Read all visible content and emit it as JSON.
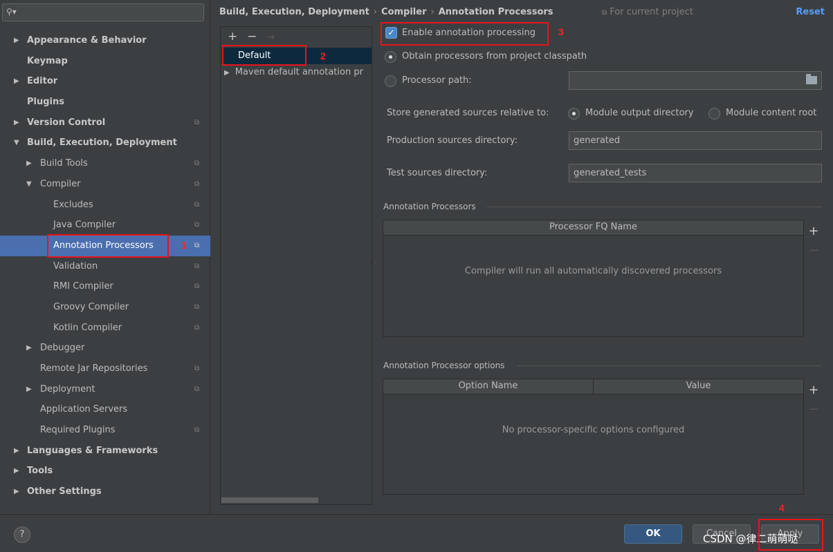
{
  "search": {
    "icon": "search-icon"
  },
  "nav": [
    {
      "label": "Appearance & Behavior",
      "arrow": "▶",
      "level": 0,
      "bold": true,
      "proj": false
    },
    {
      "label": "Keymap",
      "arrow": "",
      "level": 0,
      "bold": true,
      "proj": false
    },
    {
      "label": "Editor",
      "arrow": "▶",
      "level": 0,
      "bold": true,
      "proj": false
    },
    {
      "label": "Plugins",
      "arrow": "",
      "level": 0,
      "bold": true,
      "proj": false
    },
    {
      "label": "Version Control",
      "arrow": "▶",
      "level": 0,
      "bold": true,
      "proj": true
    },
    {
      "label": "Build, Execution, Deployment",
      "arrow": "▼",
      "level": 0,
      "bold": true,
      "proj": false
    },
    {
      "label": "Build Tools",
      "arrow": "▶",
      "level": 1,
      "bold": false,
      "proj": true
    },
    {
      "label": "Compiler",
      "arrow": "▼",
      "level": 1,
      "bold": false,
      "proj": true
    },
    {
      "label": "Excludes",
      "arrow": "",
      "level": 2,
      "bold": false,
      "proj": true
    },
    {
      "label": "Java Compiler",
      "arrow": "",
      "level": 2,
      "bold": false,
      "proj": true
    },
    {
      "label": "Annotation Processors",
      "arrow": "",
      "level": 2,
      "bold": false,
      "proj": true,
      "selected": true
    },
    {
      "label": "Validation",
      "arrow": "",
      "level": 2,
      "bold": false,
      "proj": true
    },
    {
      "label": "RMI Compiler",
      "arrow": "",
      "level": 2,
      "bold": false,
      "proj": true
    },
    {
      "label": "Groovy Compiler",
      "arrow": "",
      "level": 2,
      "bold": false,
      "proj": true
    },
    {
      "label": "Kotlin Compiler",
      "arrow": "",
      "level": 2,
      "bold": false,
      "proj": true
    },
    {
      "label": "Debugger",
      "arrow": "▶",
      "level": 1,
      "bold": false,
      "proj": false
    },
    {
      "label": "Remote Jar Repositories",
      "arrow": "",
      "level": 1,
      "bold": false,
      "proj": true
    },
    {
      "label": "Deployment",
      "arrow": "▶",
      "level": 1,
      "bold": false,
      "proj": true
    },
    {
      "label": "Application Servers",
      "arrow": "",
      "level": 1,
      "bold": false,
      "proj": false
    },
    {
      "label": "Required Plugins",
      "arrow": "",
      "level": 1,
      "bold": false,
      "proj": true
    },
    {
      "label": "Languages & Frameworks",
      "arrow": "▶",
      "level": 0,
      "bold": true,
      "proj": false
    },
    {
      "label": "Tools",
      "arrow": "▶",
      "level": 0,
      "bold": true,
      "proj": false
    },
    {
      "label": "Other Settings",
      "arrow": "▶",
      "level": 0,
      "bold": true,
      "proj": false
    }
  ],
  "header": {
    "crumbs": [
      "Build, Execution, Deployment",
      "Compiler",
      "Annotation Processors"
    ],
    "separator": "›",
    "for_project": "For current project",
    "reset": "Reset"
  },
  "profiles": {
    "add": "+",
    "remove": "−",
    "move": "→",
    "items": [
      "Default",
      "Maven default annotation pr"
    ],
    "expand_arrow": "▶"
  },
  "settings": {
    "enable_label": "Enable annotation processing",
    "enable_checked": true,
    "obtain_label": "Obtain processors from project classpath",
    "processor_path_label": "Processor path:",
    "processor_path_value": "",
    "store_label": "Store generated sources relative to:",
    "module_output": "Module output directory",
    "module_content": "Module content root",
    "production_label": "Production sources directory:",
    "production_value": "generated",
    "test_label": "Test sources directory:",
    "test_value": "generated_tests"
  },
  "processors_table": {
    "group_title": "Annotation Processors",
    "column": "Processor FQ Name",
    "empty": "Compiler will run all automatically discovered processors",
    "add": "+",
    "remove": "−"
  },
  "options_table": {
    "group_title": "Annotation Processor options",
    "col_name": "Option Name",
    "col_value": "Value",
    "empty": "No processor-specific options configured",
    "add": "+",
    "remove": "−"
  },
  "footer": {
    "help": "?",
    "ok": "OK",
    "cancel": "Cancel",
    "apply": "Apply",
    "watermark": "CSDN @律二萌萌哒"
  },
  "annotations": [
    "1",
    "2",
    "3",
    "4"
  ],
  "colors": {
    "accent": "#4b6eaf",
    "annotation": "#e8141b",
    "link": "#589df6"
  }
}
